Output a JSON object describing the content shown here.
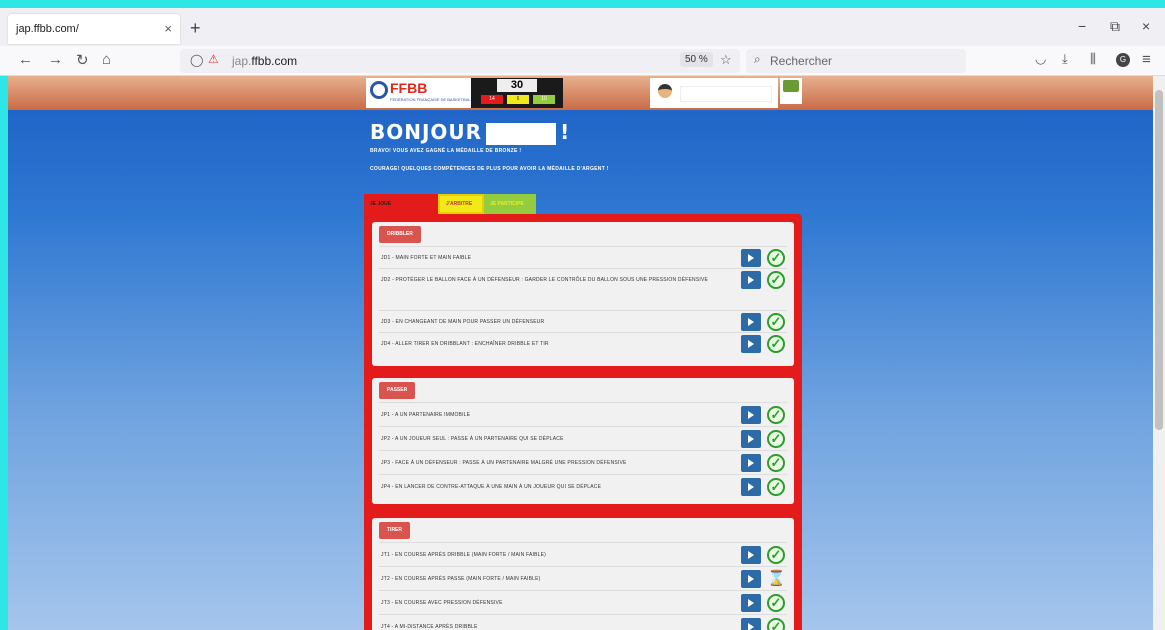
{
  "browser": {
    "tab_title": "jap.ffbb.com/",
    "tab_close": "×",
    "new_tab": "+",
    "url_prefix": "jap.",
    "url_domain": "ffbb.com",
    "zoom": "50 %",
    "search_placeholder": "Rechercher",
    "window_min": "−",
    "window_max": "⧉",
    "window_close": "×"
  },
  "header": {
    "logo_text": "FFBB",
    "logo_sub": "FÉDÉRATION FRANÇAISE DE BASKETBALL",
    "score": "30",
    "score_boxes": [
      "14",
      "6",
      "10"
    ]
  },
  "greeting": {
    "hello": "BONJOUR",
    "exclaim": "!",
    "line1": "BRAVO! VOUS AVEZ GAGNÉ LA MÉDAILLE DE BRONZE !",
    "line2": "COURAGE! QUELQUES COMPÉTENCES DE PLUS POUR AVOIR LA MÉDAILLE D'ARGENT !"
  },
  "role_tabs": [
    "JE JOUE",
    "J'ARBITRE",
    "JE PARTICIPE"
  ],
  "sections": [
    {
      "title": "DRIBBLER",
      "skills": [
        {
          "label": "JD1 - MAIN FORTE ET MAIN FAIBLE",
          "status": "done"
        },
        {
          "label": "JD2 - PROTÉGER LE BALLON FACE À UN DÉFENSEUR : GARDER LE CONTRÔLE DU BALLON SOUS UNE PRESSION DÉFENSIVE",
          "status": "done"
        },
        {
          "label": "JD3 - EN CHANGEANT DE MAIN POUR PASSER UN DÉFENSEUR",
          "status": "done"
        },
        {
          "label": "JD4 - ALLER TIRER EN DRIBBLANT : ENCHAÎNER DRIBBLE ET TIR",
          "status": "done"
        }
      ]
    },
    {
      "title": "PASSER",
      "skills": [
        {
          "label": "JP1 - A UN PARTENAIRE IMMOBILE",
          "status": "done"
        },
        {
          "label": "JP2 - A UN JOUEUR SEUL : PASSE À UN PARTENAIRE QUI SE DÉPLACE",
          "status": "done"
        },
        {
          "label": "JP3 - FACE À UN DÉFENSEUR : PASSE À UN PARTENAIRE MALGRÉ UNE PRESSION DÉFENSIVE",
          "status": "done"
        },
        {
          "label": "JP4 - EN LANCER DE CONTRE-ATTAQUE À UNE MAIN À UN JOUEUR QUI SE DÉPLACE",
          "status": "done"
        }
      ]
    },
    {
      "title": "TIRER",
      "skills": [
        {
          "label": "JT1 - EN COURSE APRÈS DRIBBLE (MAIN FORTE / MAIN FAIBLE)",
          "status": "done"
        },
        {
          "label": "JT2 - EN COURSE APRÈS PASSE (MAIN FORTE / MAIN FAIBLE)",
          "status": "pending"
        },
        {
          "label": "JT3 - EN COURSE AVEC PRESSION DÉFENSIVE",
          "status": "done"
        },
        {
          "label": "JT4 - A MI-DISTANCE APRÈS DRIBBLE",
          "status": "done"
        }
      ]
    }
  ],
  "colors": {
    "panel_red": "#e41b1b",
    "section_title": "#d9544f",
    "play_blue": "#2c6aa8",
    "check_green": "#27a327"
  }
}
